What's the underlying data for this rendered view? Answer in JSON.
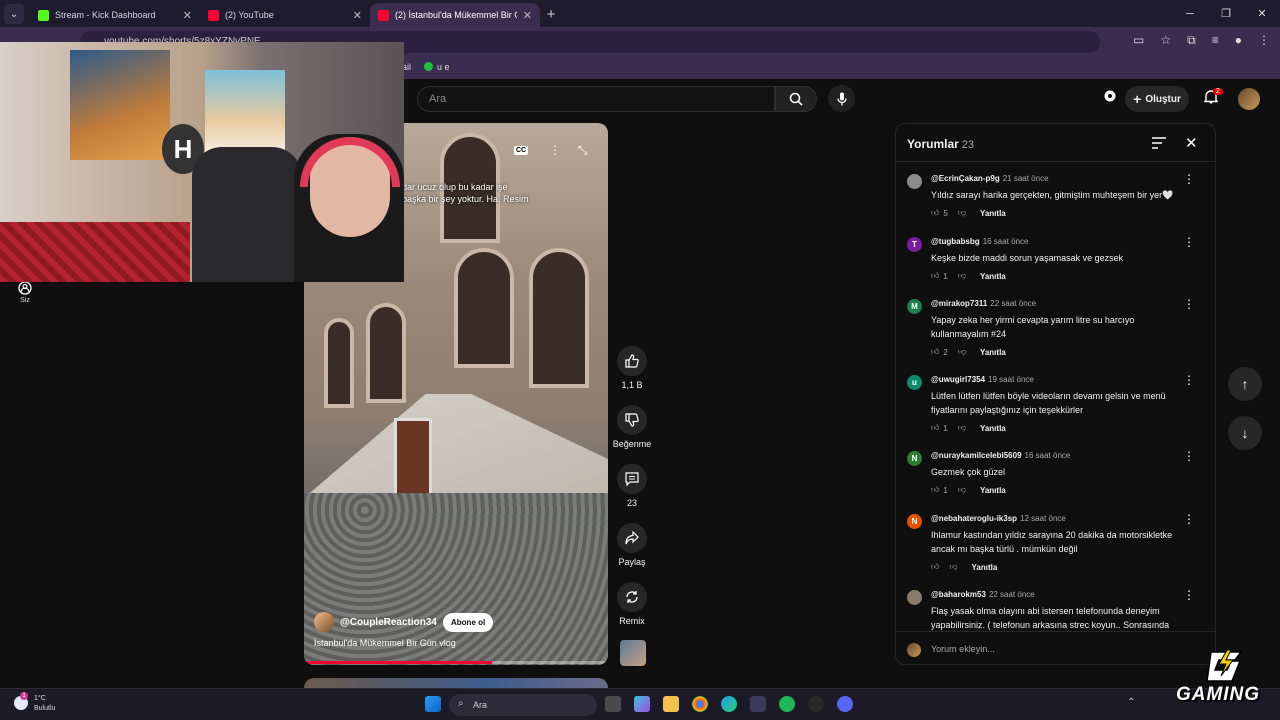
{
  "browser": {
    "tabs": [
      {
        "title": "Stream - Kick Dashboard",
        "favicon_color": "#53fc18"
      },
      {
        "title": "(2) YouTube",
        "favicon_color": "#ff0033"
      },
      {
        "title": "(2) İstanbul'da Mükemmel Bir G",
        "favicon_color": "#ff0033"
      }
    ],
    "url": "youtube.com/shorts/5z8xYZNvPNE",
    "bookmarks": [
      {
        "label": "ail"
      },
      {
        "label": "u e"
      }
    ]
  },
  "youtube": {
    "search_placeholder": "Ara",
    "create_label": "Oluştur",
    "notif_count": "2",
    "sidebar_you_label": "Siz"
  },
  "video": {
    "caption_line1": "dar ucuz olup bu kadar işe",
    "caption_line2": "başka bir şey yoktur. Ha. Resim",
    "cc_label": "CC",
    "channel": "@CoupleReaction34",
    "subscribe_label": "Abone ol",
    "title": "İstanbul'da Mükemmel Bir Gün vlog",
    "progress": 0.62
  },
  "actions": {
    "like_count": "1,1 B",
    "dislike_label": "Beğenme",
    "comment_count": "23",
    "share_label": "Paylaş",
    "remix_label": "Remix"
  },
  "comments": {
    "heading": "Yorumlar",
    "count": "23",
    "reply_label": "Yanıtla",
    "add_placeholder": "Yorum ekleyin...",
    "items": [
      {
        "author": "@EcrinÇakan-p9g",
        "time": "21 saat önce",
        "text": "Yıldız sarayı harika gerçekten, gitmiştim muhteşem bir yer🤍",
        "likes": "5",
        "avatar_letter": "",
        "avatar_color": "#8a8a8a"
      },
      {
        "author": "@tugbabsbg",
        "time": "16 saat önce",
        "text": "Keşke bizde maddi sorun yaşamasak ve gezsek",
        "likes": "1",
        "avatar_letter": "T",
        "avatar_color": "#7b1fa2"
      },
      {
        "author": "@mirakop7311",
        "time": "22 saat önce",
        "text": "Yapay zeka her yirmi cevapta yarım litre su harcıyo kullanmayalım #24",
        "likes": "2",
        "avatar_letter": "M",
        "avatar_color": "#1b7f4f"
      },
      {
        "author": "@uwugirl7354",
        "time": "19 saat önce",
        "text": "Lütfen lütfen lütfen böyle videoların devamı gelsin ve menü fiyatlarını paylaştığınız için teşekkürler",
        "likes": "1",
        "avatar_letter": "u",
        "avatar_color": "#0f8a6a"
      },
      {
        "author": "@nuraykamilcelebi5609",
        "time": "16 saat önce",
        "text": "Gezmek çok güzel",
        "likes": "1",
        "avatar_letter": "N",
        "avatar_color": "#2e7d32"
      },
      {
        "author": "@nebahateroglu-ik3sp",
        "time": "12 saat önce",
        "text": "Ihlamur kastından yıldız sarayına 20 dakika da motorsikletke ancak mı başka türlü .  mümkün değil",
        "likes": "",
        "avatar_letter": "N",
        "avatar_color": "#e65100"
      },
      {
        "author": "@baharokm53",
        "time": "22 saat önce",
        "text": "Flaş yasak olma olayını abi istersen telefonunda deneyim yapabilirsiniz. ( telefonun arkasına strec koyun.. Sonrasında",
        "likes": "",
        "avatar_letter": "",
        "avatar_color": "#8a7a6a"
      }
    ]
  },
  "taskbar": {
    "temp": "1°C",
    "weather": "Bulutlu",
    "weather_badge": "1",
    "search_label": "Ara"
  },
  "overlay": {
    "brand": "GAMING"
  }
}
